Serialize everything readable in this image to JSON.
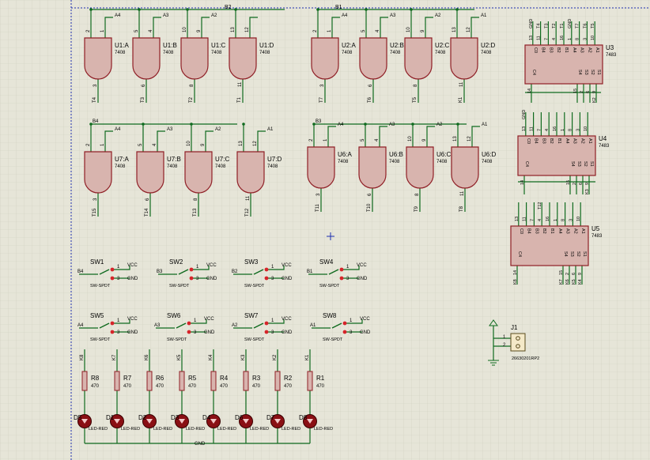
{
  "colors": {
    "background": "#e6e5d8",
    "grid": "#cfcfbf",
    "body_fill": "#d8b4ae",
    "body_stroke": "#8f1e25",
    "wire": "#0f6a1e",
    "text": "#000000",
    "led_fill": "#8a0f14",
    "switch_pad": "#d6242a",
    "border": "#1d2fb0"
  },
  "buses": {
    "top_left": "B2",
    "top_right": "B1"
  },
  "gates": [
    {
      "ref": "U1:A",
      "type": "7408",
      "in": [
        "2",
        "1"
      ],
      "out": "3",
      "input_labels": [
        "A4",
        ""
      ],
      "out_label": "T4"
    },
    {
      "ref": "U1:B",
      "type": "7408",
      "in": [
        "5",
        "4"
      ],
      "out": "6",
      "input_labels": [
        "A3",
        ""
      ],
      "out_label": "T3"
    },
    {
      "ref": "U1:C",
      "type": "7408",
      "in": [
        "10",
        "9"
      ],
      "out": "8",
      "input_labels": [
        "A2",
        ""
      ],
      "out_label": "T2"
    },
    {
      "ref": "U1:D",
      "type": "7408",
      "in": [
        "13",
        "12"
      ],
      "out": "11",
      "input_labels": [
        "",
        ""
      ],
      "out_label": "T1"
    },
    {
      "ref": "U2:A",
      "type": "7408",
      "in": [
        "2",
        "1"
      ],
      "out": "3",
      "input_labels": [
        "A4",
        ""
      ],
      "out_label": "T7"
    },
    {
      "ref": "U2:B",
      "type": "7408",
      "in": [
        "5",
        "4"
      ],
      "out": "6",
      "input_labels": [
        "A3",
        ""
      ],
      "out_label": "T6"
    },
    {
      "ref": "U2:C",
      "type": "7408",
      "in": [
        "10",
        "9"
      ],
      "out": "8",
      "input_labels": [
        "A2",
        ""
      ],
      "out_label": "T5"
    },
    {
      "ref": "U2:D",
      "type": "7408",
      "in": [
        "13",
        "12"
      ],
      "out": "11",
      "input_labels": [
        "A1",
        ""
      ],
      "out_label": "K1"
    },
    {
      "ref": "U7:A",
      "type": "7408",
      "in": [
        "2",
        "1"
      ],
      "out": "3",
      "input_labels": [
        "A4",
        "B4"
      ],
      "out_label": "T15"
    },
    {
      "ref": "U7:B",
      "type": "7408",
      "in": [
        "5",
        "4"
      ],
      "out": "6",
      "input_labels": [
        "A3",
        ""
      ],
      "out_label": "T14"
    },
    {
      "ref": "U7:C",
      "type": "7408",
      "in": [
        "10",
        "9"
      ],
      "out": "8",
      "input_labels": [
        "A2",
        ""
      ],
      "out_label": "T13"
    },
    {
      "ref": "U7:D",
      "type": "7408",
      "in": [
        "13",
        "12"
      ],
      "out": "11",
      "input_labels": [
        "A1",
        ""
      ],
      "out_label": "T12"
    },
    {
      "ref": "U6:A",
      "type": "7408",
      "in": [
        "2",
        "1"
      ],
      "out": "3",
      "input_labels": [
        "A4",
        "B3"
      ],
      "out_label": "T11"
    },
    {
      "ref": "U6:B",
      "type": "7408",
      "in": [
        "5",
        "4"
      ],
      "out": "6",
      "input_labels": [
        "A3",
        ""
      ],
      "out_label": "T10"
    },
    {
      "ref": "U6:C",
      "type": "7408",
      "in": [
        "10",
        "9"
      ],
      "out": "8",
      "input_labels": [
        "A2",
        ""
      ],
      "out_label": "T9"
    },
    {
      "ref": "U6:D",
      "type": "7408",
      "in": [
        "13",
        "12"
      ],
      "out": "11",
      "input_labels": [
        "A1",
        ""
      ],
      "out_label": "T8"
    }
  ],
  "adders": [
    {
      "ref": "U3",
      "type": "7483",
      "top_pins": [
        "C0",
        "B4",
        "B3",
        "B2",
        "B1",
        "A4",
        "A3",
        "A2",
        "A1"
      ],
      "top_pin_numbers": [
        "13",
        "11",
        "7",
        "4",
        "16",
        "1",
        "8",
        "3",
        "10"
      ],
      "top_nets": [
        "GND",
        "T4",
        "T3",
        "T2",
        "T1",
        "GND",
        "T7",
        "T6",
        "T5"
      ],
      "bottom_pins": [
        "C4",
        "S4",
        "S3",
        "S2",
        "S1"
      ],
      "bottom_pin_numbers": [
        "14",
        "15",
        "2",
        "6",
        "9"
      ],
      "bottom_nets": [
        "",
        "",
        "",
        "",
        "K2"
      ]
    },
    {
      "ref": "U4",
      "type": "7483",
      "top_pins": [
        "C0",
        "B4",
        "B3",
        "B2",
        "B1",
        "A4",
        "A3",
        "A2",
        "A1"
      ],
      "top_pin_numbers": [
        "13",
        "11",
        "7",
        "4",
        "16",
        "1",
        "8",
        "3",
        "10"
      ],
      "top_nets": [
        "GND",
        "",
        "",
        "",
        "",
        "",
        "",
        "",
        ""
      ],
      "bottom_pins": [
        "C4",
        "S4",
        "S3",
        "S2",
        "S1"
      ],
      "bottom_pin_numbers": [
        "14",
        "15",
        "2",
        "6",
        "9"
      ],
      "bottom_nets": [
        "",
        "",
        "",
        "",
        "K3"
      ]
    },
    {
      "ref": "U5",
      "type": "7483",
      "top_pins": [
        "C0",
        "B4",
        "B3",
        "B2",
        "B1",
        "A4",
        "A3",
        "A2",
        "A1"
      ],
      "top_pin_numbers": [
        "13",
        "11",
        "7",
        "4",
        "16",
        "1",
        "8",
        "3",
        "10"
      ],
      "top_nets": [
        "",
        "",
        "",
        "T12",
        "",
        "",
        "",
        "",
        ""
      ],
      "bottom_pins": [
        "C4",
        "S4",
        "S3",
        "S2",
        "S1"
      ],
      "bottom_pin_numbers": [
        "14",
        "15",
        "2",
        "6",
        "9"
      ],
      "bottom_nets": [
        "K8",
        "K7",
        "K6",
        "K5",
        "K4"
      ]
    }
  ],
  "switches": [
    {
      "ref": "SW1",
      "type": "SW-SPDT",
      "net": "B4",
      "vcc": "VCC",
      "gnd": "GND",
      "pin_top": "1",
      "pin_bottom": "3"
    },
    {
      "ref": "SW2",
      "type": "SW-SPDT",
      "net": "B3",
      "vcc": "VCC",
      "gnd": "GND",
      "pin_top": "1",
      "pin_bottom": "3"
    },
    {
      "ref": "SW3",
      "type": "SW-SPDT",
      "net": "B2",
      "vcc": "VCC",
      "gnd": "GND",
      "pin_top": "1",
      "pin_bottom": "3"
    },
    {
      "ref": "SW4",
      "type": "SW-SPDT",
      "net": "B1",
      "vcc": "VCC",
      "gnd": "GND",
      "pin_top": "1",
      "pin_bottom": "3"
    },
    {
      "ref": "SW5",
      "type": "SW-SPDT",
      "net": "A4",
      "vcc": "VCC",
      "gnd": "GND",
      "pin_top": "1",
      "pin_bottom": "3"
    },
    {
      "ref": "SW6",
      "type": "SW-SPDT",
      "net": "A3",
      "vcc": "VCC",
      "gnd": "GND",
      "pin_top": "1",
      "pin_bottom": "3"
    },
    {
      "ref": "SW7",
      "type": "SW-SPDT",
      "net": "A2",
      "vcc": "VCC",
      "gnd": "GND",
      "pin_top": "1",
      "pin_bottom": "3"
    },
    {
      "ref": "SW8",
      "type": "SW-SPDT",
      "net": "A1",
      "vcc": "VCC",
      "gnd": "GND",
      "pin_top": "1",
      "pin_bottom": "3"
    }
  ],
  "resistors": [
    {
      "ref": "R8",
      "value": "470",
      "net": "K8"
    },
    {
      "ref": "R7",
      "value": "470",
      "net": "K7"
    },
    {
      "ref": "R6",
      "value": "470",
      "net": "K6"
    },
    {
      "ref": "R5",
      "value": "470",
      "net": "K5"
    },
    {
      "ref": "R4",
      "value": "470",
      "net": "K4"
    },
    {
      "ref": "R3",
      "value": "470",
      "net": "K3"
    },
    {
      "ref": "R2",
      "value": "470",
      "net": "K2"
    },
    {
      "ref": "R1",
      "value": "470",
      "net": "K1"
    }
  ],
  "leds": [
    {
      "ref": "D5",
      "type": "LED-RED"
    },
    {
      "ref": "D1",
      "type": "LED-RED"
    },
    {
      "ref": "D2",
      "type": "LED-RED"
    },
    {
      "ref": "D3",
      "type": "LED-RED"
    },
    {
      "ref": "D4",
      "type": "LED-RED"
    },
    {
      "ref": "D6",
      "type": "LED-RED"
    },
    {
      "ref": "D7",
      "type": "LED-RED"
    },
    {
      "ref": "D8",
      "type": "LED-RED"
    }
  ],
  "led_gnd_label": "GND",
  "connector": {
    "ref": "J1",
    "part": "26630201RP2",
    "pins": [
      "1",
      "2"
    ]
  }
}
